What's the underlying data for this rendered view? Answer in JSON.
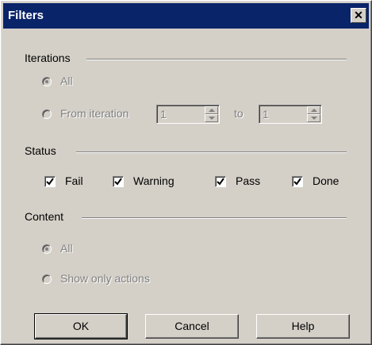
{
  "dialog": {
    "title": "Filters",
    "close_glyph": "✕"
  },
  "iterations": {
    "label": "Iterations",
    "all_label": "All",
    "from_label": "From iteration",
    "from_value": "1",
    "to_label": "to",
    "to_value": "1",
    "all_selected": true
  },
  "status": {
    "label": "Status",
    "items": [
      {
        "label": "Fail",
        "checked": true
      },
      {
        "label": "Warning",
        "checked": true
      },
      {
        "label": "Pass",
        "checked": true
      },
      {
        "label": "Done",
        "checked": true
      }
    ]
  },
  "content": {
    "label": "Content",
    "all_label": "All",
    "show_actions_label": "Show only actions",
    "all_selected": true
  },
  "buttons": {
    "ok": "OK",
    "cancel": "Cancel",
    "help": "Help"
  },
  "colors": {
    "dialog_bg": "#d4d0c8",
    "titlebar": "#0a246a",
    "disabled_text": "#808080"
  }
}
